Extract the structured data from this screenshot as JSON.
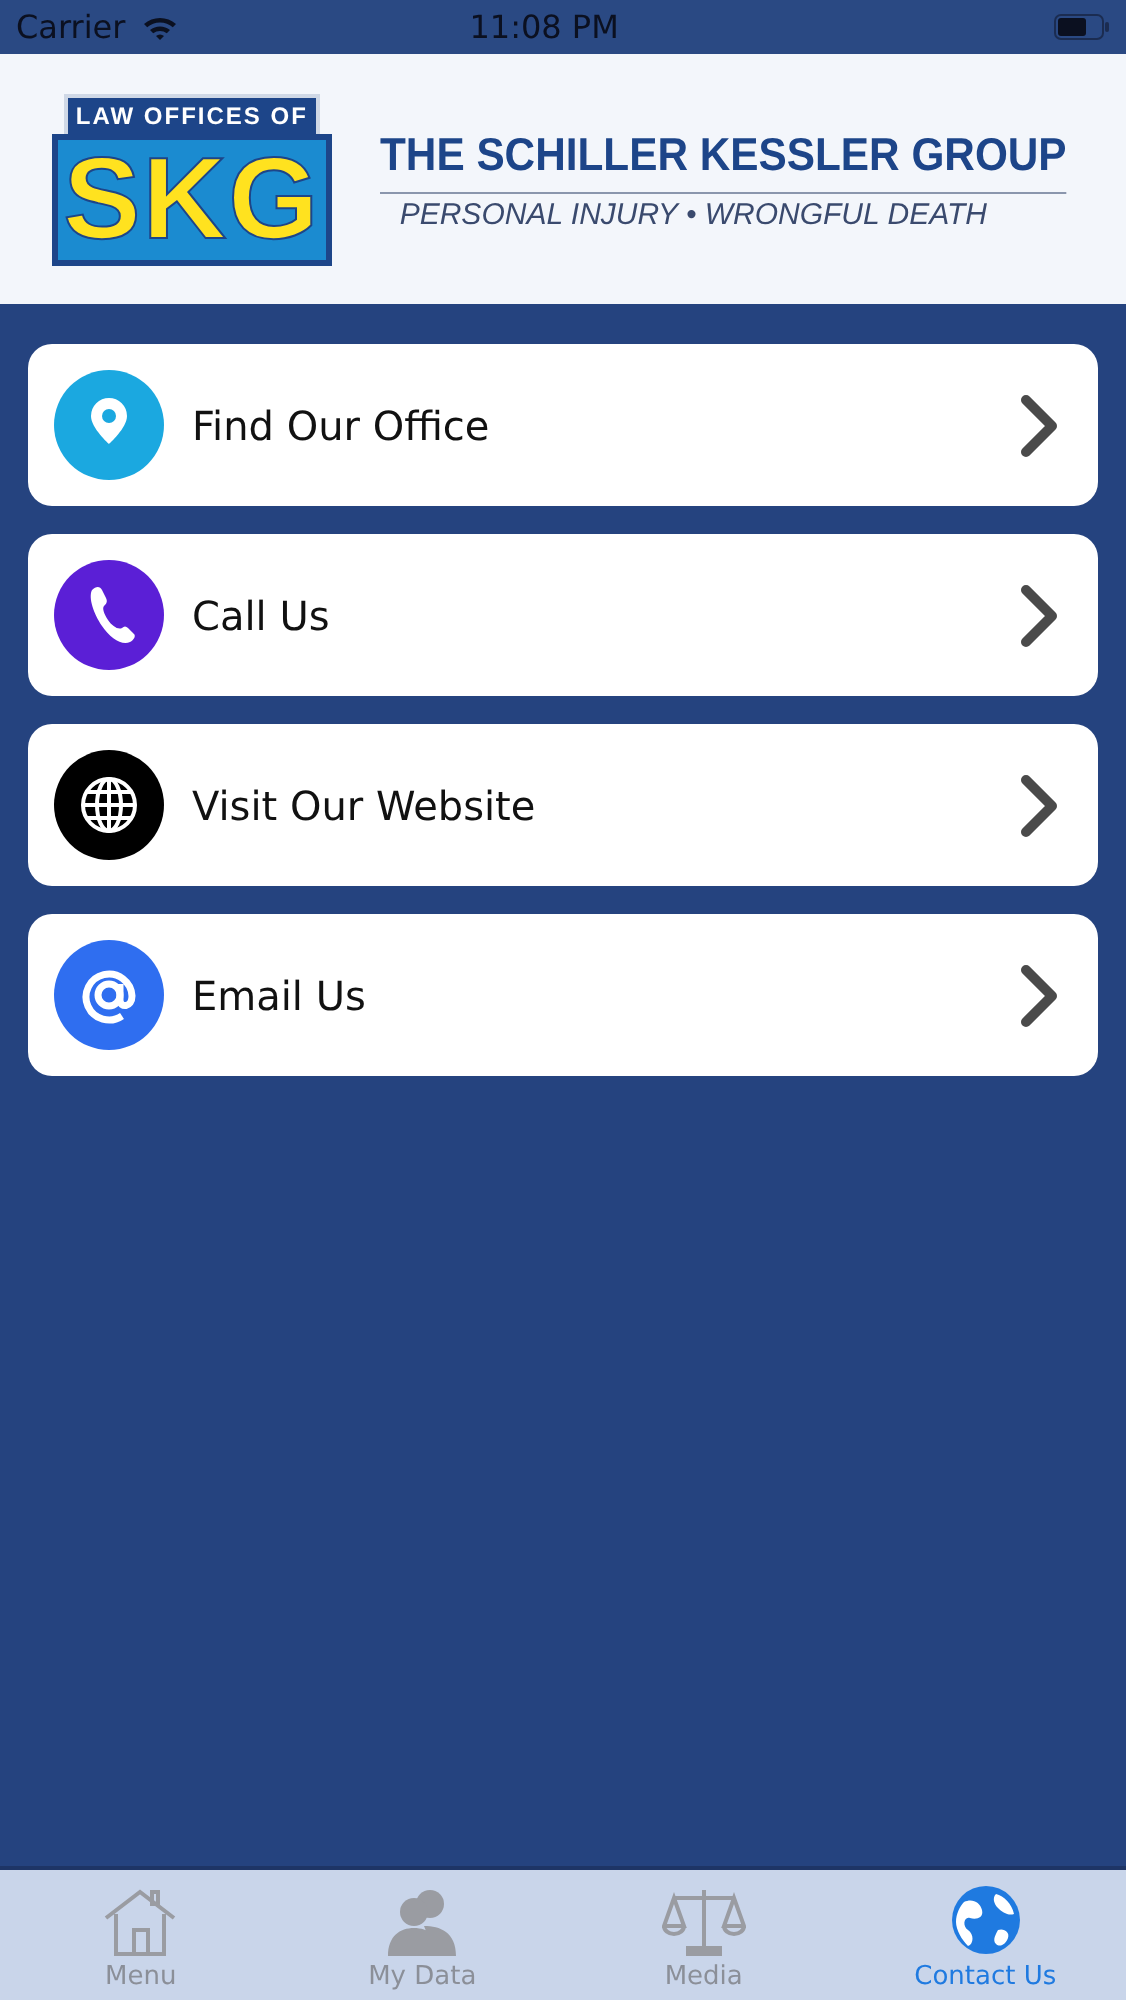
{
  "status_bar": {
    "carrier": "Carrier",
    "time": "11:08 PM"
  },
  "header": {
    "logo_top": "LAW OFFICES OF",
    "logo_main": "SKG",
    "firm_name": "THE SCHILLER KESSLER GROUP",
    "tagline": "PERSONAL INJURY • WRONGFUL DEATH"
  },
  "items": [
    {
      "kind": "pin",
      "label": "Find Our Office",
      "color": "#1ba8e0"
    },
    {
      "kind": "phone",
      "label": "Call Us",
      "color": "#5b1fd6"
    },
    {
      "kind": "globe",
      "label": "Visit Our Website",
      "color": "#000000"
    },
    {
      "kind": "at",
      "label": "Email Us",
      "color": "#2f6ef0"
    }
  ],
  "tabs": [
    {
      "kind": "house",
      "label": "Menu",
      "selected": false
    },
    {
      "kind": "people",
      "label": "My Data",
      "selected": false
    },
    {
      "kind": "scales",
      "label": "Media",
      "selected": false
    },
    {
      "kind": "earth",
      "label": "Contact Us",
      "selected": true
    }
  ]
}
